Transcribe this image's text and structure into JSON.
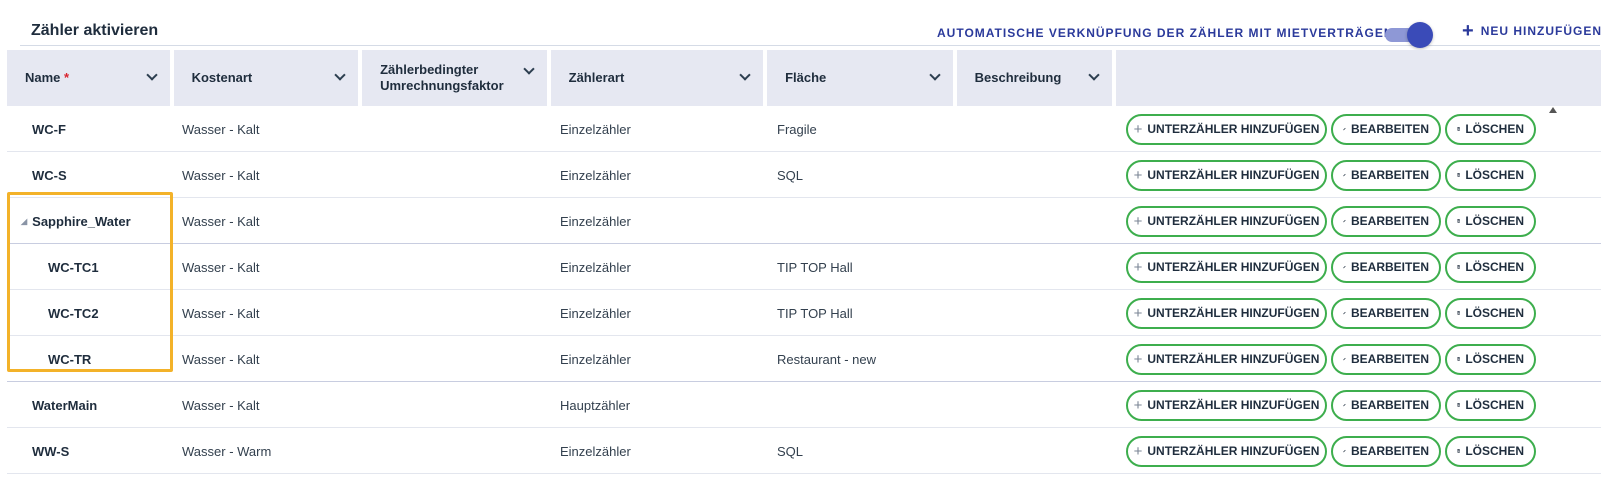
{
  "header": {
    "title": "Zähler aktivieren",
    "toggle_label": "AUTOMATISCHE VERKNÜPFUNG DER ZÄHLER MIT MIETVERTRÄGEN",
    "toggle_on": true,
    "add_new_label": "NEU HINZUFÜGEN"
  },
  "columns": {
    "name": "Name",
    "name_required": "*",
    "kostenart": "Kostenart",
    "faktor_line1": "Zählerbedingter",
    "faktor_line2": "Umrechnungsfaktor",
    "zaehlerart": "Zählerart",
    "flaeche": "Fläche",
    "beschreibung": "Beschreibung"
  },
  "actions": {
    "sub_label": "UNTERZÄHLER HINZUFÜGEN",
    "edit_label": "BEARBEITEN",
    "delete_label": "LÖSCHEN"
  },
  "rows": [
    {
      "name": "WC-F",
      "kostenart": "Wasser - Kalt",
      "zaehlerart": "Einzelzähler",
      "flaeche": "Fragile"
    },
    {
      "name": "WC-S",
      "kostenart": "Wasser - Kalt",
      "zaehlerart": "Einzelzähler",
      "flaeche": "SQL"
    },
    {
      "name": "Sapphire_Water",
      "kostenart": "Wasser - Kalt",
      "zaehlerart": "Einzelzähler",
      "flaeche": ""
    },
    {
      "name": "WC-TC1",
      "kostenart": "Wasser - Kalt",
      "zaehlerart": "Einzelzähler",
      "flaeche": "TIP TOP Hall"
    },
    {
      "name": "WC-TC2",
      "kostenart": "Wasser - Kalt",
      "zaehlerart": "Einzelzähler",
      "flaeche": "TIP TOP Hall"
    },
    {
      "name": "WC-TR",
      "kostenart": "Wasser - Kalt",
      "zaehlerart": "Einzelzähler",
      "flaeche": "Restaurant - new"
    },
    {
      "name": "WaterMain",
      "kostenart": "Wasser - Kalt",
      "zaehlerart": "Hauptzähler",
      "flaeche": ""
    },
    {
      "name": "WW-S",
      "kostenart": "Wasser - Warm",
      "zaehlerart": "Einzelzähler",
      "flaeche": "SQL"
    }
  ],
  "colors": {
    "accent": "#2b3a9b",
    "button_border": "#3dae4d",
    "highlight": "#f3b229",
    "header_bg": "#e6e8f2"
  }
}
